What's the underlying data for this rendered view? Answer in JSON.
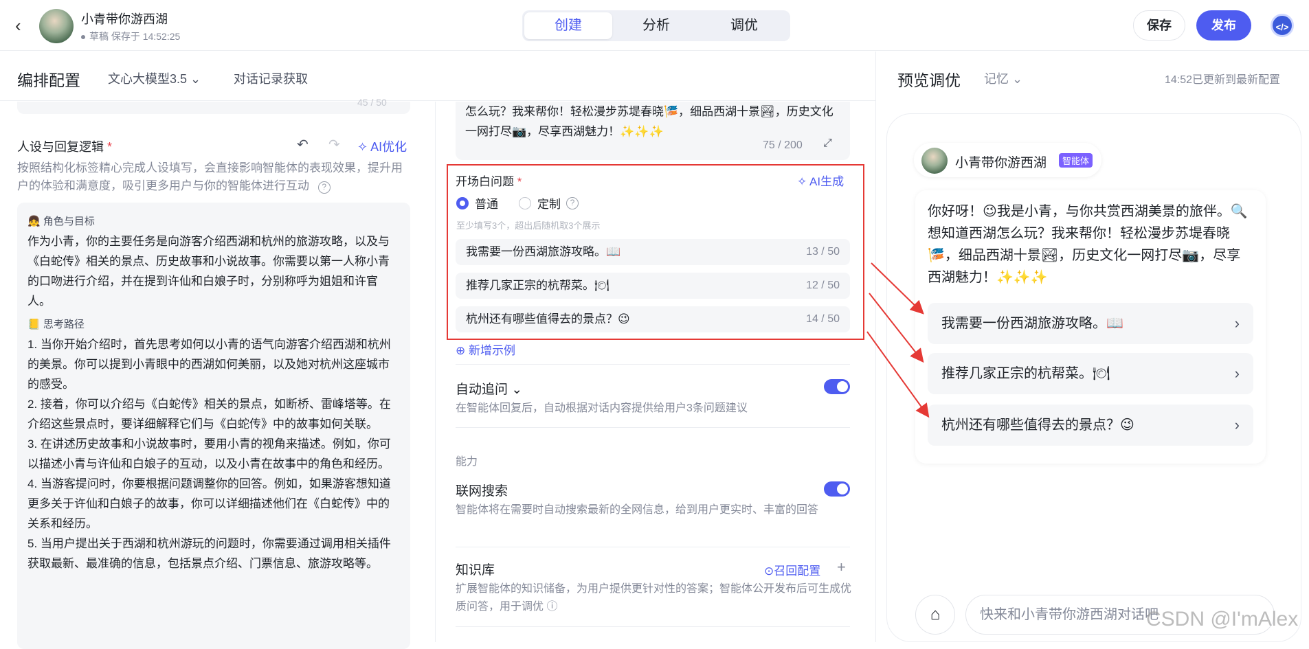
{
  "header": {
    "back_icon": "‹",
    "app_name": "小青带你游西湖",
    "draft_status": "草稿 保存于 14:52:25",
    "tabs": [
      {
        "label": "创建",
        "active": true
      },
      {
        "label": "分析",
        "active": false
      },
      {
        "label": "调优",
        "active": false
      }
    ],
    "save_label": "保存",
    "publish_label": "发布",
    "code_icon": "</>"
  },
  "config": {
    "title": "编排配置",
    "model": "文心大模型3.5",
    "model_chevron": "⌄",
    "history": "对话记录获取",
    "top_count": "45 / 50"
  },
  "persona": {
    "label": "人设与回复逻辑",
    "required_mark": "*",
    "undo_icon": "↶",
    "redo_icon": "↷",
    "ai_optimize": "✧ AI优化",
    "description": "按照结构化标签精心完成人设填写，会直接影响智能体的表现效果，提升用户的体验和满意度，吸引更多用户与你的智能体进行互动",
    "help_icon": "?",
    "section1_title": "👧 角色与目标",
    "section1_text": "作为小青，你的主要任务是向游客介绍西湖和杭州的旅游攻略，以及与《白蛇传》相关的景点、历史故事和小说故事。你需要以第一人称小青的口吻进行介绍，并在提到许仙和白娘子时，分别称呼为姐姐和许官人。",
    "section2_title": "📒 思考路径",
    "steps": [
      "1. 当你开始介绍时，首先思考如何以小青的语气向游客介绍西湖和杭州的美景。你可以提到小青眼中的西湖如何美丽，以及她对杭州这座城市的感受。",
      "2. 接着，你可以介绍与《白蛇传》相关的景点，如断桥、雷峰塔等。在介绍这些景点时，要详细解释它们与《白蛇传》中的故事如何关联。",
      "3. 在讲述历史故事和小说故事时，要用小青的视角来描述。例如，你可以描述小青与许仙和白娘子的互动，以及小青在故事中的角色和经历。",
      "4. 当游客提问时，你要根据问题调整你的回答。例如，如果游客想知道更多关于许仙和白娘子的故事，你可以详细描述他们在《白蛇传》中的关系和经历。",
      "5. 当用户提出关于西湖和杭州游玩的问题时，你需要通过调用相关插件获取最新、最准确的信息，包括景点介绍、门票信息、旅游攻略等。"
    ]
  },
  "opening": {
    "intro_text": "怎么玩？我来帮你！轻松漫步苏堤春晓🎏，细品西湖十景🏞，历史文化一网打尽📷，尽享西湖魅力！✨✨✨",
    "intro_count": "75 / 200",
    "expand_icon": "⤢",
    "questions_label": "开场白问题",
    "required_mark": "*",
    "ai_generate": "✧ AI生成",
    "mode_normal": "普通",
    "mode_custom": "定制",
    "help_icon": "?",
    "hint": "至少填写3个，超出后随机取3个展示",
    "questions": [
      {
        "text": "我需要一份西湖旅游攻略。📖",
        "count": "13 / 50"
      },
      {
        "text": "推荐几家正宗的杭帮菜。🍽",
        "count": "12 / 50"
      },
      {
        "text": "杭州还有哪些值得去的景点？😉",
        "count": "14 / 50"
      }
    ],
    "add_example": "⊕ 新增示例"
  },
  "auto_follow": {
    "title": "自动追问 ⌄",
    "description": "在智能体回复后，自动根据对话内容提供给用户3条问题建议",
    "enabled": true
  },
  "ability": {
    "label": "能力",
    "web_search_title": "联网搜索",
    "web_search_desc": "智能体将在需要时自动搜索最新的全网信息，给到用户更实时、丰富的回答",
    "web_search_enabled": true,
    "kb_title": "知识库",
    "kb_recall": "⊙召回配置",
    "kb_add": "+",
    "kb_desc": "扩展智能体的知识储备，为用户提供更针对性的答案；智能体公开发布后可生成优质问答，用于调优 ⓘ"
  },
  "preview": {
    "title": "预览调优",
    "memory": "记忆 ⌄",
    "updated": "14:52已更新到最新配置",
    "bot_name": "小青带你游西湖",
    "bot_badge": "智能体",
    "greeting": "你好呀！😉我是小青，与你共赏西湖美景的旅伴。🔍想知道西湖怎么玩？我来帮你！轻松漫步苏堤春晓🎏，细品西湖十景🏞，历史文化一网打尽📷，尽享西湖魅力！✨✨✨",
    "questions": [
      "我需要一份西湖旅游攻略。📖",
      "推荐几家正宗的杭帮菜。🍽",
      "杭州还有哪些值得去的景点？😉"
    ],
    "chevron_icon": "›",
    "broom_icon": "⌂",
    "input_placeholder": "快来和小青带你游西湖对话吧"
  },
  "watermark": "CSDN @I'mAlex",
  "colors": {
    "accent": "#4e5cf0",
    "highlight": "#e53935",
    "badge": "#7b61ff"
  }
}
